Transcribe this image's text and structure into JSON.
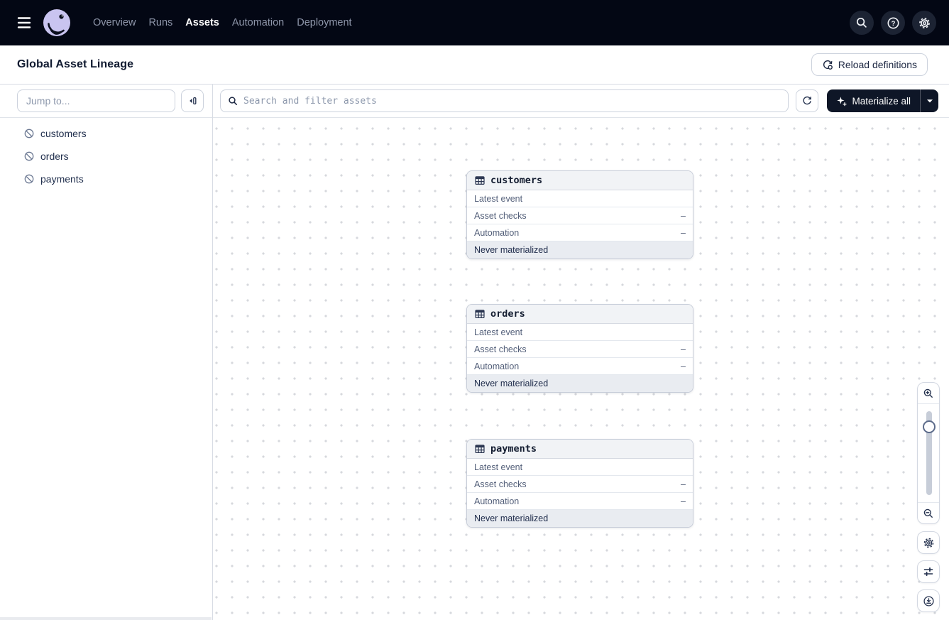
{
  "navbar": {
    "items": [
      "Overview",
      "Runs",
      "Assets",
      "Automation",
      "Deployment"
    ],
    "active_item": "Assets",
    "icons": [
      "menu-icon",
      "dagster-logo",
      "search-icon",
      "help-icon",
      "settings-icon"
    ]
  },
  "header": {
    "title": "Global Asset Lineage",
    "reload_button_label": "Reload definitions",
    "reload_icon": "reload-definitions-icon"
  },
  "left_panel": {
    "jump_to_placeholder": "Jump to...",
    "collapse_icon": "collapse-panel-icon",
    "asset_icon": "asset-disabled-icon",
    "assets": [
      "customers",
      "orders",
      "payments"
    ]
  },
  "toolbar": {
    "search_placeholder": "Search and filter assets",
    "search_icon": "search-icon",
    "refresh_icon": "refresh-icon",
    "materialize_button_label": "Materialize all",
    "materialize_icon": "sparkle-icon",
    "caret_icon": "caret-down-icon"
  },
  "graph": {
    "node_icon": "table-icon",
    "nodes": [
      {
        "name": "customers",
        "rows": [
          {
            "label": "Latest event",
            "value": ""
          },
          {
            "label": "Asset checks",
            "value": "–"
          },
          {
            "label": "Automation",
            "value": "–"
          }
        ],
        "status": "Never materialized"
      },
      {
        "name": "orders",
        "rows": [
          {
            "label": "Latest event",
            "value": ""
          },
          {
            "label": "Asset checks",
            "value": "–"
          },
          {
            "label": "Automation",
            "value": "–"
          }
        ],
        "status": "Never materialized"
      },
      {
        "name": "payments",
        "rows": [
          {
            "label": "Latest event",
            "value": ""
          },
          {
            "label": "Asset checks",
            "value": "–"
          },
          {
            "label": "Automation",
            "value": "–"
          }
        ],
        "status": "Never materialized"
      }
    ],
    "view_controls": [
      "zoom-in-icon",
      "zoom-slider",
      "zoom-out-icon",
      "settings-gear-icon",
      "filter-sliders-icon",
      "recenter-icon"
    ]
  },
  "colors": {
    "navbar_bg": "#030714",
    "accent_dark_button": "#0e1627",
    "logo_lavender": "#c9c4f0",
    "border": "#d6dae2",
    "muted_text": "#54607a",
    "status_footer_bg": "#e9ecf1",
    "node_header_bg": "#f1f3f6",
    "dot_grid": "#d6d8dd"
  }
}
